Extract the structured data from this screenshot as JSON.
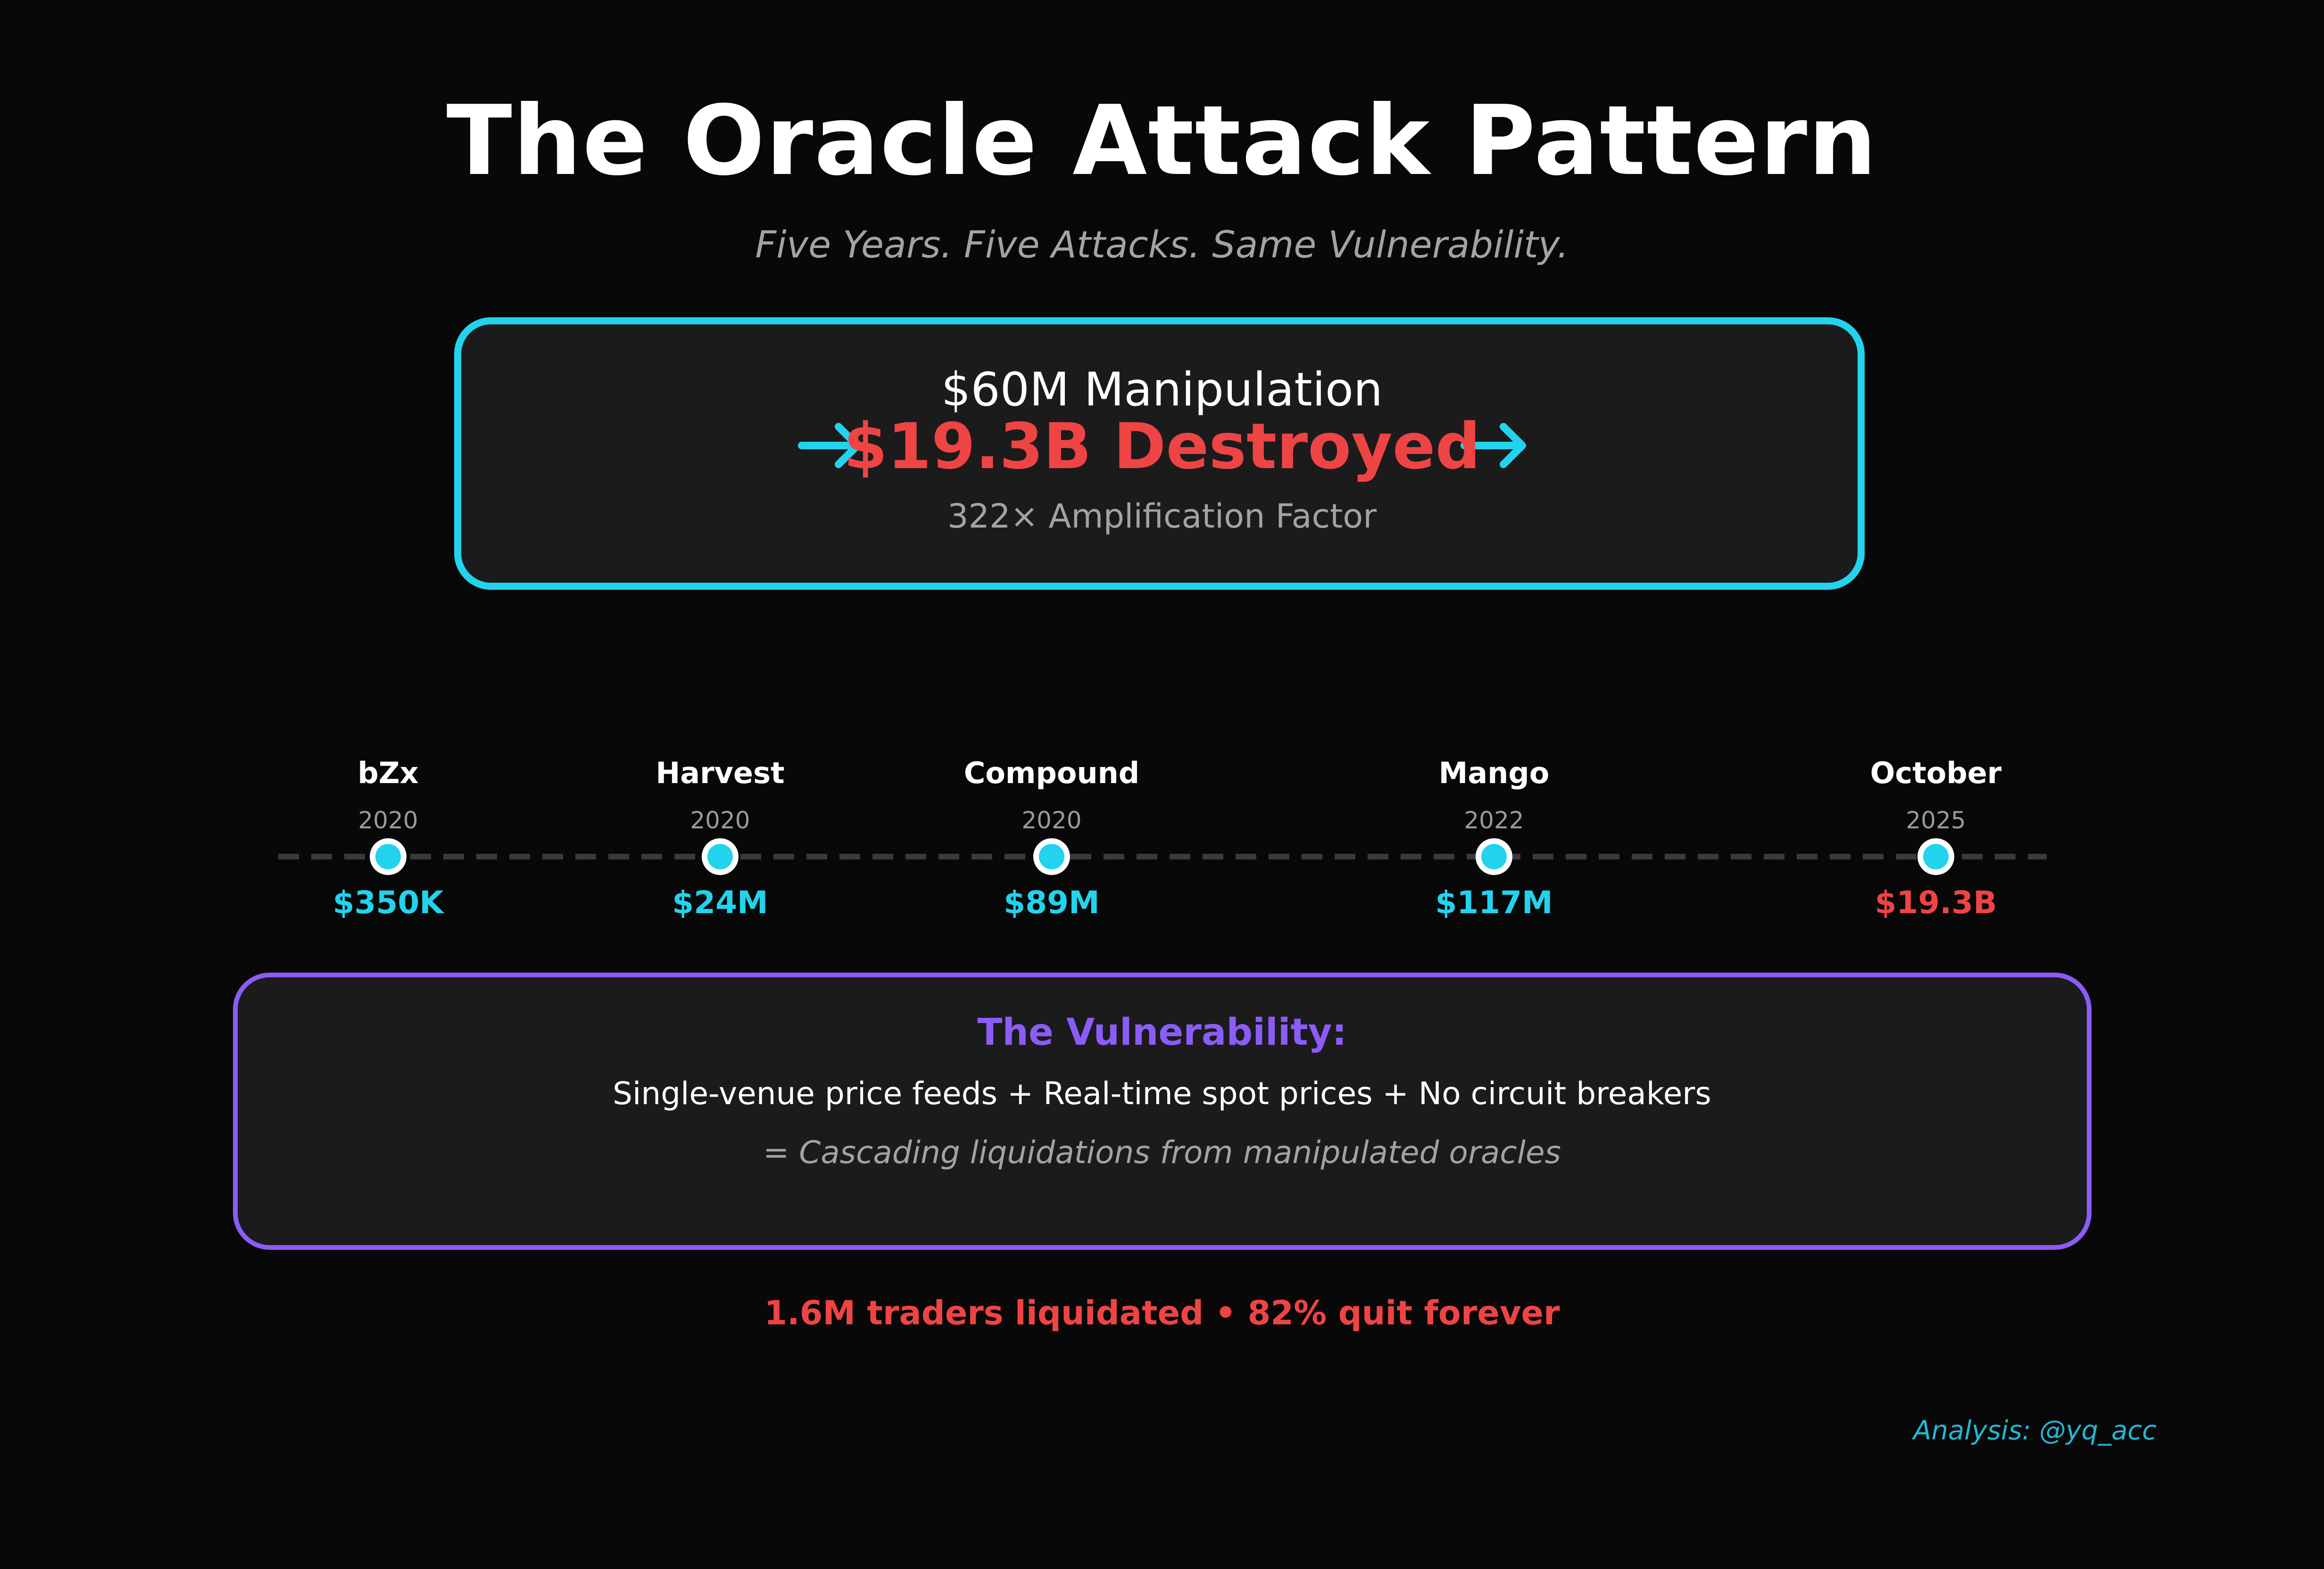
{
  "header": {
    "title": "The Oracle Attack Pattern",
    "subtitle": "Five Years. Five Attacks. Same Vulnerability."
  },
  "hero": {
    "manipulation": "$60M Manipulation",
    "destroyed": "$19.3B Destroyed",
    "amplification": "322× Amplification Factor"
  },
  "timeline": {
    "events": [
      {
        "name": "bZx",
        "year": "2020",
        "amount": "$350K"
      },
      {
        "name": "Harvest",
        "year": "2020",
        "amount": "$24M"
      },
      {
        "name": "Compound",
        "year": "2020",
        "amount": "$89M"
      },
      {
        "name": "Mango",
        "year": "2022",
        "amount": "$117M"
      },
      {
        "name": "October",
        "year": "2025",
        "amount": "$19.3B"
      }
    ]
  },
  "vulnerability": {
    "title": "The Vulnerability:",
    "causes": "Single-venue price feeds + Real-time spot prices + No circuit breakers",
    "result": "= Cascading liquidations from manipulated oracles"
  },
  "footer": {
    "stats": "1.6M traders liquidated  •  82% quit forever",
    "credit": "Analysis: @yq_acc"
  },
  "colors": {
    "background": "#080808",
    "accent_cyan": "#22d3ee",
    "accent_red": "#ef4444",
    "accent_purple": "#8b5cf6",
    "muted_text": "#a3a3a3"
  }
}
